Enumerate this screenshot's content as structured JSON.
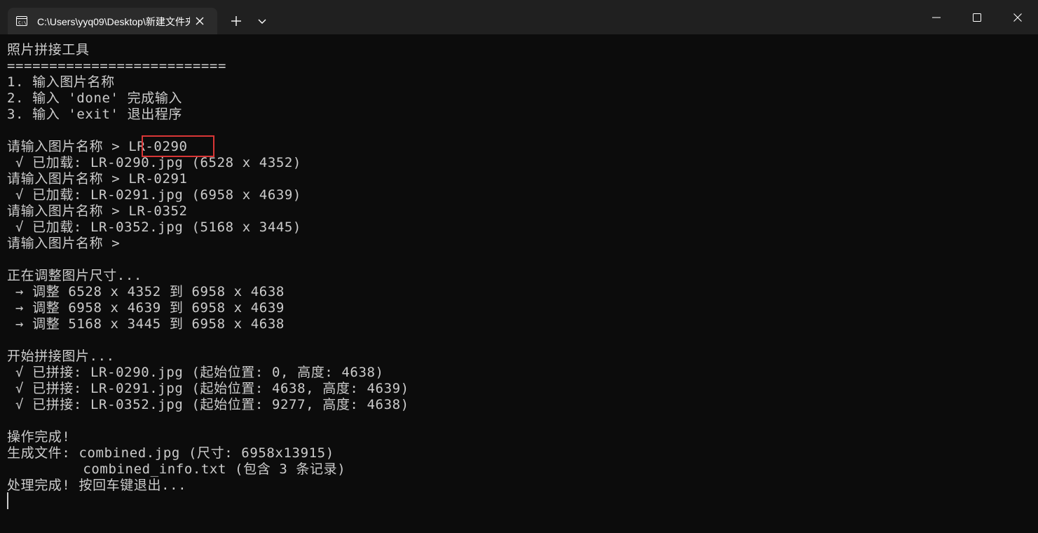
{
  "window": {
    "tab_title": "C:\\Users\\yyq09\\Desktop\\新建文件夹",
    "icons": {
      "tab": "terminal-icon",
      "close_tab": "close-icon",
      "new_tab": "plus-icon",
      "dropdown": "chevron-down-icon",
      "minimize": "minimize-icon",
      "maximize": "maximize-icon",
      "close": "close-icon"
    }
  },
  "terminal": {
    "lines": [
      "照片拼接工具",
      "==========================",
      "1. 输入图片名称",
      "2. 输入 'done' 完成输入",
      "3. 输入 'exit' 退出程序",
      "",
      "请输入图片名称 > LR-0290",
      " √ 已加载: LR-0290.jpg (6528 x 4352)",
      "请输入图片名称 > LR-0291",
      " √ 已加载: LR-0291.jpg (6958 x 4639)",
      "请输入图片名称 > LR-0352",
      " √ 已加载: LR-0352.jpg (5168 x 3445)",
      "请输入图片名称 >",
      "",
      "正在调整图片尺寸...",
      " → 调整 6528 x 4352 到 6958 x 4638",
      " → 调整 6958 x 4639 到 6958 x 4639",
      " → 调整 5168 x 3445 到 6958 x 4638",
      "",
      "开始拼接图片...",
      " √ 已拼接: LR-0290.jpg (起始位置: 0, 高度: 4638)",
      " √ 已拼接: LR-0291.jpg (起始位置: 4638, 高度: 4639)",
      " √ 已拼接: LR-0352.jpg (起始位置: 9277, 高度: 4638)",
      "",
      "操作完成!",
      "生成文件: combined.jpg (尺寸: 6958x13915)",
      "         combined_info.txt (包含 3 条记录)",
      "处理完成! 按回车键退出..."
    ]
  },
  "colors": {
    "terminal_bg": "#0c0c0c",
    "titlebar_bg": "#202020",
    "tab_bg": "#2b2b2b",
    "text": "#cccccc",
    "highlight_border": "#d93636"
  }
}
